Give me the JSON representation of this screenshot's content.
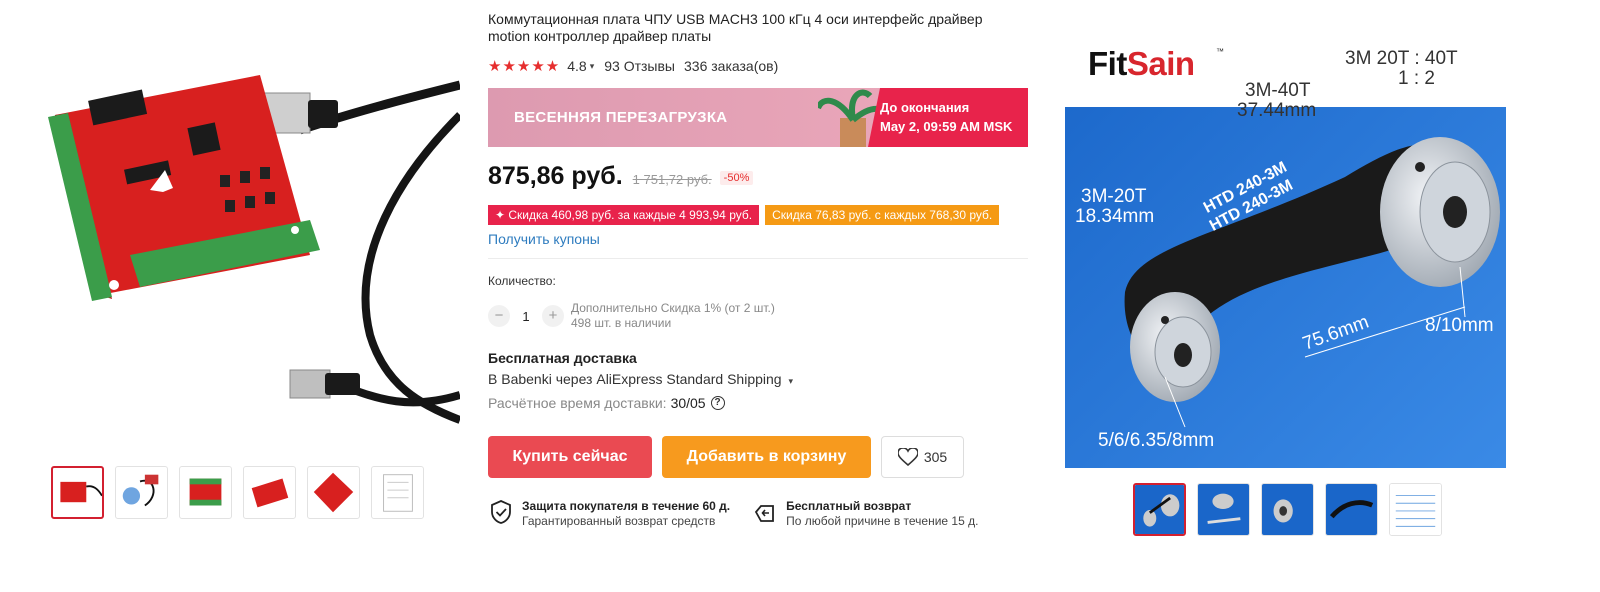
{
  "product": {
    "title": "Коммутационная плата ЧПУ USB MACH3 100 кГц 4 оси интерфейс драйвер motion контроллер драйвер платы",
    "stars": "★★★★★",
    "rating": "4.8",
    "reviews": "93 Отзывы",
    "orders": "336 заказа(ов)"
  },
  "promo": {
    "banner": "ВЕСЕННЯЯ ПЕРЕЗАГРУЗКА",
    "until_label": "До окончания",
    "until_date": "May 2, 09:59 AM MSK"
  },
  "price": {
    "current": "875,86 руб.",
    "old": "1 751,72 руб.",
    "discount": "-50%"
  },
  "coupons": {
    "pink": "✦ Скидка 460,98 руб. за каждые 4 993,94 руб.",
    "orange": "Скидка 76,83 руб. с каждых 768,30 руб.",
    "get_link": "Получить купоны"
  },
  "quantity": {
    "label": "Количество:",
    "minus": "−",
    "value": "1",
    "plus": "+",
    "note1": "Дополнительно Скидка 1% (от 2 шт.)",
    "note2": "498 шт. в наличии"
  },
  "shipping": {
    "title": "Бесплатная доставка",
    "detail": "В Babenki через AliExpress Standard Shipping",
    "time_label": "Расчётное время доставки:",
    "time_value": "30/05",
    "help": "?"
  },
  "actions": {
    "buy": "Купить сейчас",
    "cart": "Добавить в корзину",
    "wishlist_count": "305"
  },
  "guarantees": {
    "protection_title": "Защита покупателя в течение 60 д.",
    "protection_sub": "Гарантированный возврат средств",
    "return_title": "Бесплатный возврат",
    "return_sub": "По любой причине в течение 15 д."
  },
  "right_image": {
    "brand_a": "Fit",
    "brand_b": "Sain",
    "tm": "™",
    "ratio_line1": "3M  20T : 40T",
    "ratio_line2": "1 : 2",
    "big_pulley": "3M-40T",
    "big_diam": "37.44mm",
    "small_pulley": "3M-20T",
    "small_diam": "18.34mm",
    "belt_text1": "HTD 240-3M",
    "belt_text2": "HTD 240-3M",
    "bore_big": "8/10mm",
    "center_dist": "75.6mm",
    "bore_small": "5/6/6.35/8mm"
  },
  "colors": {
    "accent_red": "#e62e2e",
    "buy_button": "#ea4a52",
    "cart_button": "#f79a1e",
    "link": "#2e7cbf",
    "image_blue": "#1a66c9"
  }
}
